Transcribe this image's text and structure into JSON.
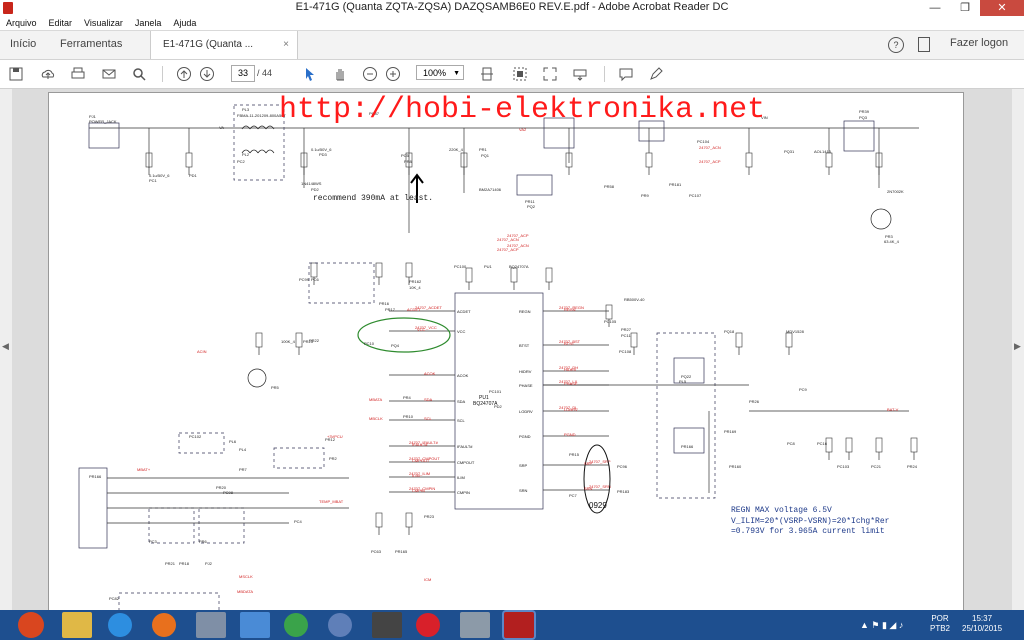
{
  "window": {
    "title": "E1-471G (Quanta ZQTA-ZQSA) DAZQSAMB6E0 REV.E.pdf - Adobe Acrobat Reader DC",
    "minimize": "—",
    "maximize": "❐",
    "close": "✕"
  },
  "menu": [
    "Arquivo",
    "Editar",
    "Visualizar",
    "Janela",
    "Ajuda"
  ],
  "tabs": {
    "home": "Início",
    "tools": "Ferramentas",
    "document": "E1-471G (Quanta ...",
    "close": "×",
    "help": "?",
    "logon": "Fazer logon"
  },
  "toolbar": {
    "page_current": "33",
    "page_total": "/ 44",
    "zoom": "100%",
    "zoom_arrow": "▼"
  },
  "watermark": "http://hobi-elektronika.net",
  "annotation": {
    "circled_label": "0929"
  },
  "notes": {
    "recommend": "recommend 390mA at least.",
    "regn": "REGN MAX voltage 6.5V",
    "ilim": "V_ILIM=20*(VSRP-VSRN)=20*Ichg*Rer",
    "ilim2": "=0.793V for 3.965A current limit"
  },
  "schematic": {
    "parts": [
      "PJ1",
      "POWER_JACK",
      "PL3",
      "FBMA-11-201209-800A50T",
      "PL2",
      "PC2",
      "0.1u/50V_6",
      "PC1",
      "PD1",
      "1N4148WS",
      "PD2",
      "PC87",
      "0.1u/50V_6",
      "PD3",
      "PC5",
      "PR8",
      "220K_4",
      "PR1",
      "PQ1",
      "BM2A71406",
      "PR11",
      "PQ2",
      "PR58",
      "PR9",
      "PR181",
      "PC107",
      "PC104",
      "PQ31",
      "AOL1413",
      "PR39",
      "PQ3",
      "2N7002K",
      "PR3",
      "63.4K_4",
      "PR162",
      "10K_4",
      "PR16",
      "PR17",
      "PC99",
      "PC6",
      "PC100",
      "PU1",
      "BQ24707A",
      "PC101",
      "PD2",
      "RB500V-40",
      "PR27",
      "PC11",
      "PC105",
      "PC108",
      "PQ18",
      "MDV1528",
      "PQ22",
      "PL5",
      "PR166",
      "PR26",
      "PC9",
      "PR169",
      "PR160",
      "PC8",
      "PC16",
      "PC103",
      "PC21",
      "PR24",
      "100K_4",
      "PR25",
      "PR22",
      "PC10",
      "PQ4",
      "PR5",
      "PR4",
      "PR10",
      "PR12",
      "PR2",
      "PC98",
      "PC102",
      "PL6",
      "PL4",
      "PR7",
      "PR20",
      "PR15",
      "PC7",
      "PC96",
      "PR183",
      "PC63",
      "PR165",
      "PR23",
      "PC4",
      "PC3",
      "PR6",
      "PR21",
      "PR18",
      "PJ2",
      "PR166",
      "PC82"
    ],
    "nets": [
      "VA",
      "VIN",
      "VA2",
      "24707_ACN",
      "24707_ACP",
      "ACDET",
      "VCC",
      "ACOK",
      "SDA",
      "SCL",
      "IFAULT#",
      "CMPOUT",
      "ILIM",
      "CMPIN",
      "REGN",
      "BTST",
      "HIDRV",
      "PHASE",
      "LODRV",
      "PGND",
      "SRP",
      "SRN",
      "BAT-V",
      "MBATA",
      "MBCLK",
      "+3VPCU",
      "ACIN",
      "MBAT+",
      "TEMP_MBAT",
      "MSCLK",
      "MBDATA",
      "ICM"
    ]
  },
  "taskbar": {
    "lang": "POR",
    "layout": "PTB2",
    "time": "15:37",
    "date": "25/10/2015"
  },
  "colors": {
    "watermark": "#ff1a1a",
    "net_labels": "#d11f1f",
    "wires": "#333333",
    "ellipse": "#2e8b2e",
    "notes": "#1e3a8a",
    "taskbar": "#1e4f8f"
  }
}
